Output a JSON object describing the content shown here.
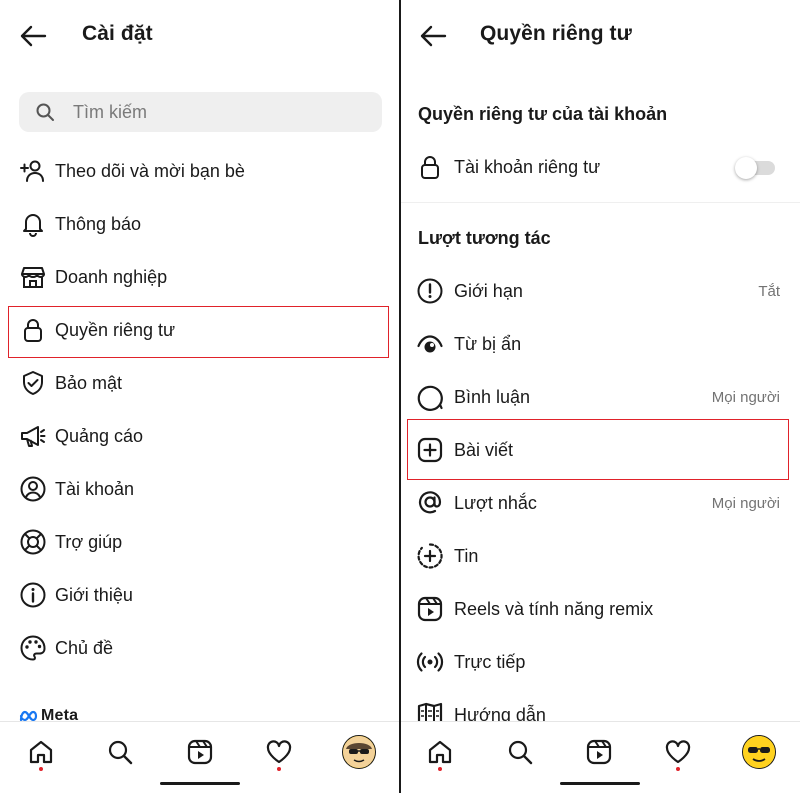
{
  "left": {
    "title": "Cài đặt",
    "search": {
      "placeholder": "Tìm kiếm"
    },
    "items": [
      {
        "label": "Theo dõi và mời bạn bè",
        "icon": "add-person-icon"
      },
      {
        "label": "Thông báo",
        "icon": "bell-icon"
      },
      {
        "label": "Doanh nghiệp",
        "icon": "shop-icon"
      },
      {
        "label": "Quyền riêng tư",
        "icon": "lock-icon"
      },
      {
        "label": "Bảo mật",
        "icon": "shield-check-icon"
      },
      {
        "label": "Quảng cáo",
        "icon": "megaphone-icon"
      },
      {
        "label": "Tài khoản",
        "icon": "account-circle-icon"
      },
      {
        "label": "Trợ giúp",
        "icon": "lifebuoy-icon"
      },
      {
        "label": "Giới thiệu",
        "icon": "info-icon"
      },
      {
        "label": "Chủ đề",
        "icon": "palette-icon"
      }
    ],
    "footer_brand": "Meta"
  },
  "right": {
    "title": "Quyền riêng tư",
    "section_account": "Quyền riêng tư của tài khoản",
    "private_account": {
      "label": "Tài khoản riêng tư",
      "enabled": false,
      "icon": "lock-icon"
    },
    "section_interactions": "Lượt tương tác",
    "items": [
      {
        "label": "Giới hạn",
        "value": "Tắt",
        "icon": "alert-circle-icon"
      },
      {
        "label": "Từ bị ẩn",
        "value": "",
        "icon": "hidden-eye-icon"
      },
      {
        "label": "Bình luận",
        "value": "Mọi người",
        "icon": "comment-icon"
      },
      {
        "label": "Bài viết",
        "value": "",
        "icon": "plus-square-icon"
      },
      {
        "label": "Lượt nhắc",
        "value": "Mọi người",
        "icon": "at-sign-icon"
      },
      {
        "label": "Tin",
        "value": "",
        "icon": "story-add-icon"
      },
      {
        "label": "Reels và tính năng remix",
        "value": "",
        "icon": "reels-icon"
      },
      {
        "label": "Trực tiếp",
        "value": "",
        "icon": "live-icon"
      },
      {
        "label": "Hướng dẫn",
        "value": "",
        "icon": "guide-map-icon"
      }
    ]
  },
  "bottom_nav": {
    "tabs": [
      {
        "name": "home",
        "icon": "home-icon",
        "notification": true
      },
      {
        "name": "search",
        "icon": "search-icon",
        "notification": false
      },
      {
        "name": "reels",
        "icon": "reels-icon",
        "notification": false
      },
      {
        "name": "activity",
        "icon": "heart-icon",
        "notification": true
      },
      {
        "name": "profile",
        "icon": "avatar-icon",
        "notification": false
      }
    ]
  },
  "colors": {
    "highlight": "#e0222a",
    "notification_dot": "#e0222a",
    "avatar": "#ffd21f",
    "search_bg": "#efefef",
    "secondary_text": "#737373"
  }
}
